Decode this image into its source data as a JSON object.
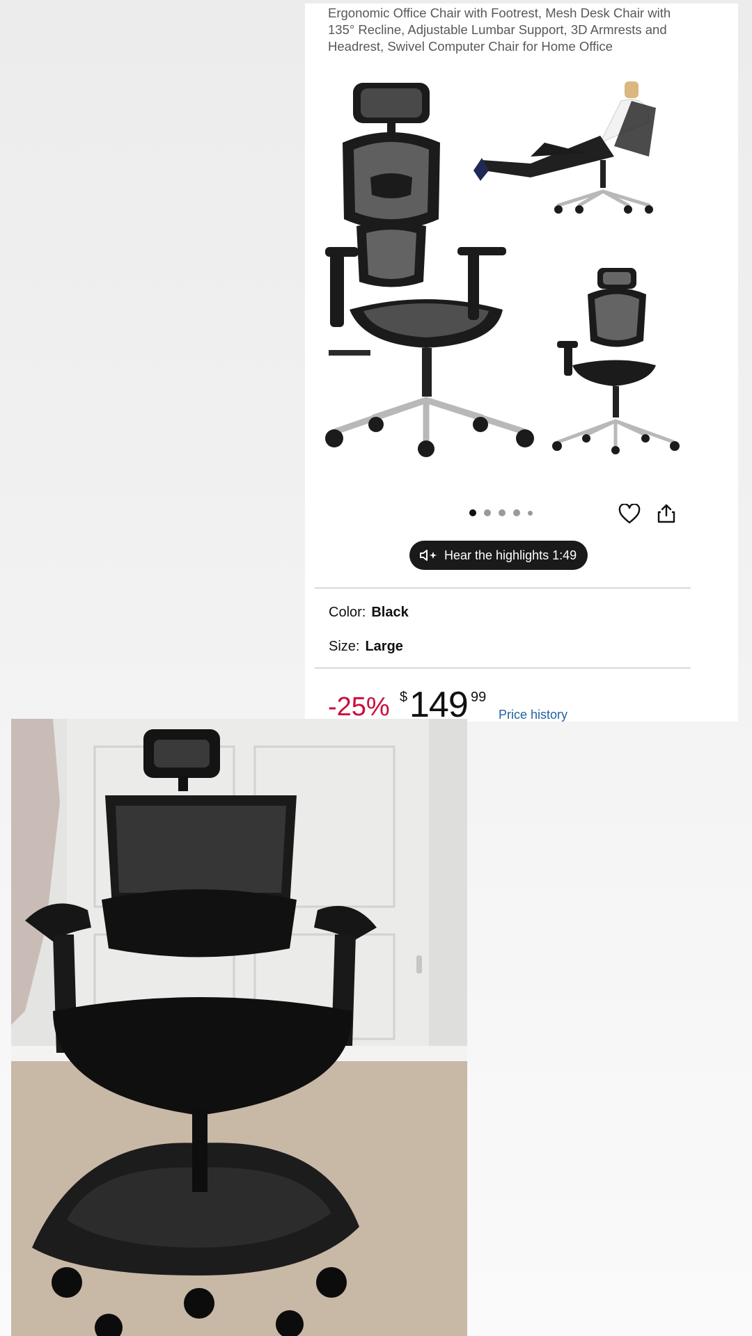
{
  "product": {
    "title": "Ergonomic Office Chair with Footrest, Mesh Desk Chair with 135° Recline, Adjustable Lumbar Support, 3D Armrests and Headrest, Swivel Computer Chair for Home Office"
  },
  "gallery": {
    "image_count": 5,
    "active_index": 0
  },
  "actions": {
    "heart_icon": "heart-icon",
    "share_icon": "share-icon"
  },
  "highlights": {
    "label": "Hear the highlights 1:49",
    "icon": "speaker-sparkle-icon"
  },
  "options": {
    "color_label": "Color:",
    "color_value": "Black",
    "size_label": "Size:",
    "size_value": "Large"
  },
  "price": {
    "discount": "-25%",
    "currency": "$",
    "whole": "149",
    "fraction": "99",
    "history_link": "Price history"
  },
  "colors": {
    "discount": "#cc0c39",
    "link": "#2162a1",
    "pill_bg": "#1a1a1a"
  }
}
